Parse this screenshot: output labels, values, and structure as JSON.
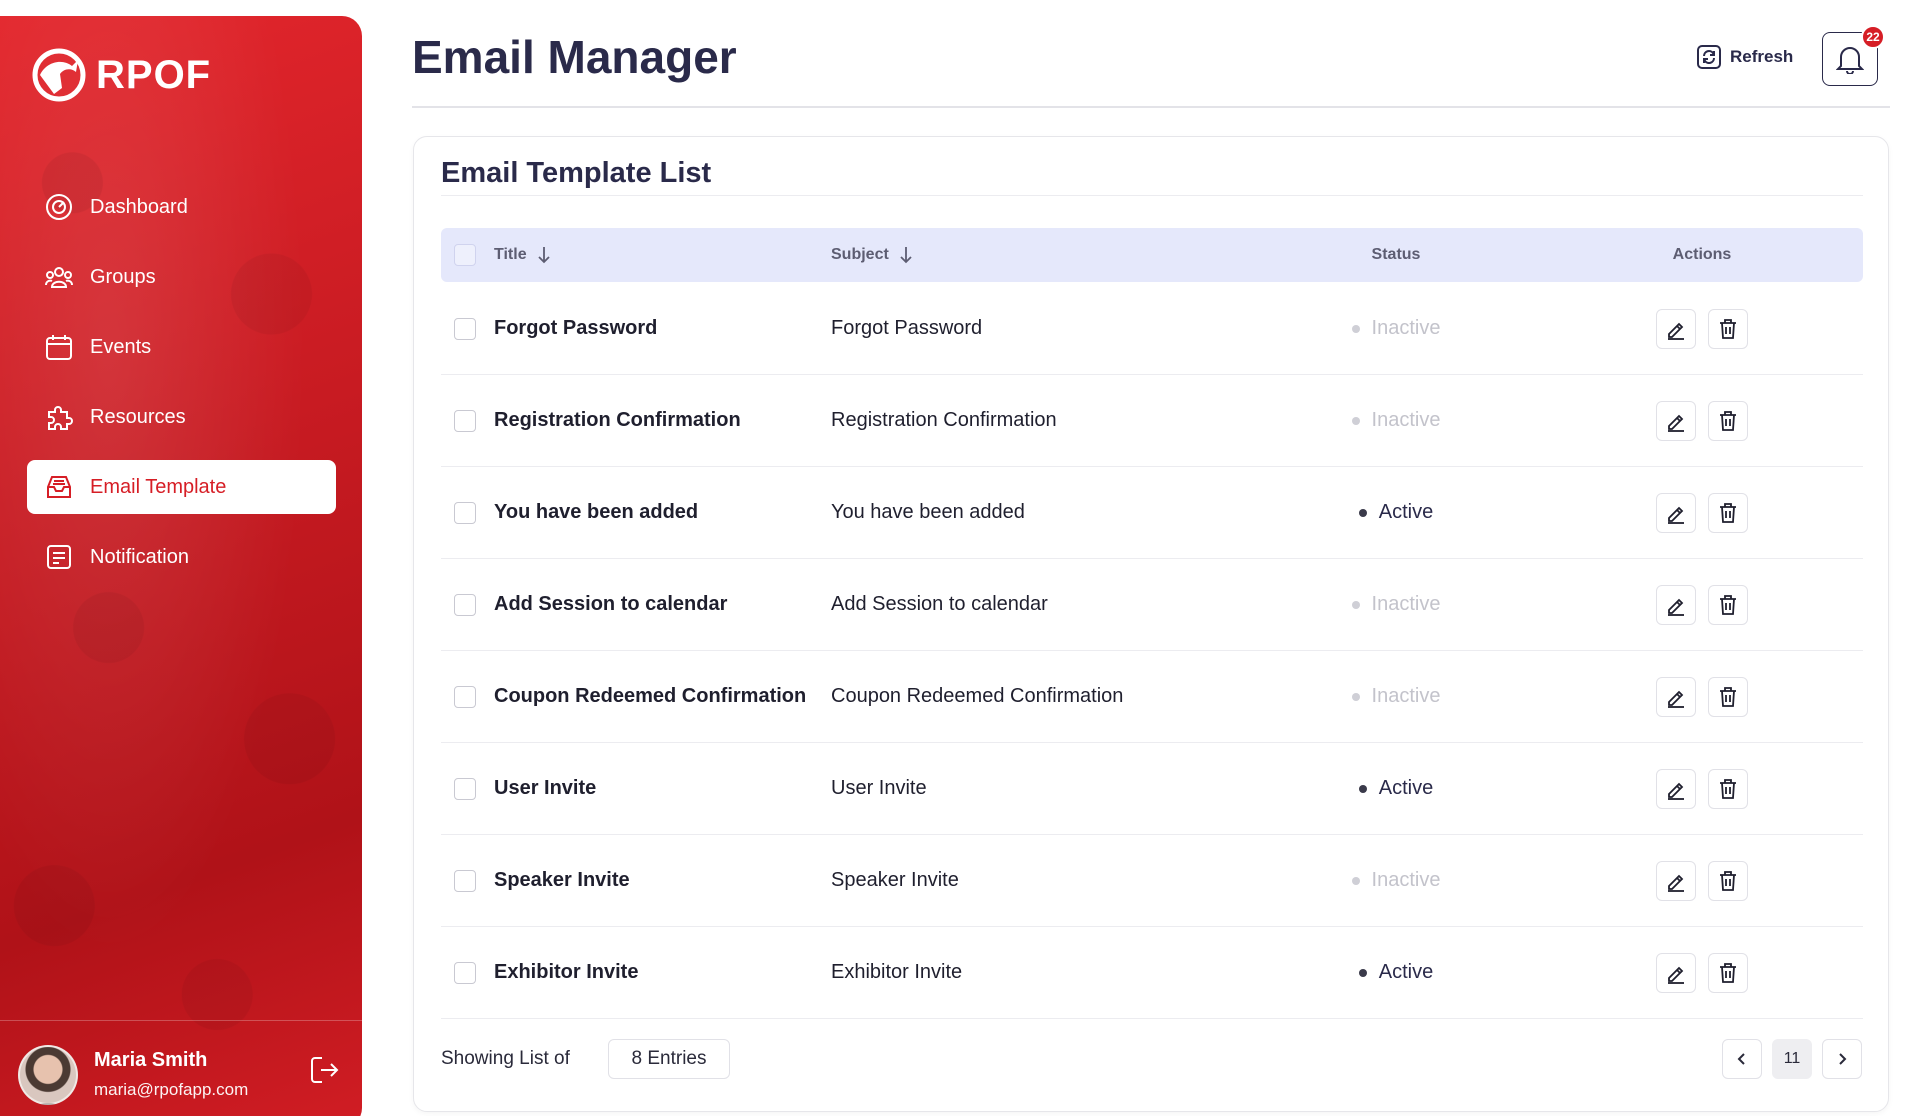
{
  "brand": {
    "name": "RPOF",
    "accent": "#d61e26"
  },
  "sidebar": {
    "items": [
      {
        "label": "Dashboard",
        "icon": "dashboard-icon",
        "active": false
      },
      {
        "label": "Groups",
        "icon": "groups-icon",
        "active": false
      },
      {
        "label": "Events",
        "icon": "calendar-icon",
        "active": false
      },
      {
        "label": "Resources",
        "icon": "puzzle-icon",
        "active": false
      },
      {
        "label": "Email Template",
        "icon": "inbox-icon",
        "active": true
      },
      {
        "label": "Notification",
        "icon": "notification-icon",
        "active": false
      }
    ],
    "user": {
      "name": "Maria Smith",
      "email": "maria@rpofapp.com"
    }
  },
  "header": {
    "title": "Email Manager",
    "refresh_label": "Refresh",
    "notification_count": "22"
  },
  "card": {
    "title": "Email Template List",
    "columns": {
      "title": "Title",
      "subject": "Subject",
      "status": "Status",
      "actions": "Actions"
    },
    "rows": [
      {
        "title": "Forgot Password",
        "subject": "Forgot Password",
        "status": "Inactive"
      },
      {
        "title": "Registration Confirmation",
        "subject": "Registration Confirmation",
        "status": "Inactive"
      },
      {
        "title": "You have been added",
        "subject": "You have been added",
        "status": "Active"
      },
      {
        "title": "Add Session to calendar",
        "subject": "Add Session to calendar",
        "status": "Inactive"
      },
      {
        "title": "Coupon Redeemed Confirmation",
        "subject": "Coupon Redeemed Confirmation",
        "status": "Inactive"
      },
      {
        "title": "User Invite",
        "subject": "User Invite",
        "status": "Active"
      },
      {
        "title": "Speaker Invite",
        "subject": "Speaker Invite",
        "status": "Inactive"
      },
      {
        "title": "Exhibitor Invite",
        "subject": "Exhibitor Invite",
        "status": "Active"
      }
    ],
    "footer": {
      "showing_label": "Showing List of",
      "entries_value": "8 Entries",
      "current_page": "11"
    }
  }
}
